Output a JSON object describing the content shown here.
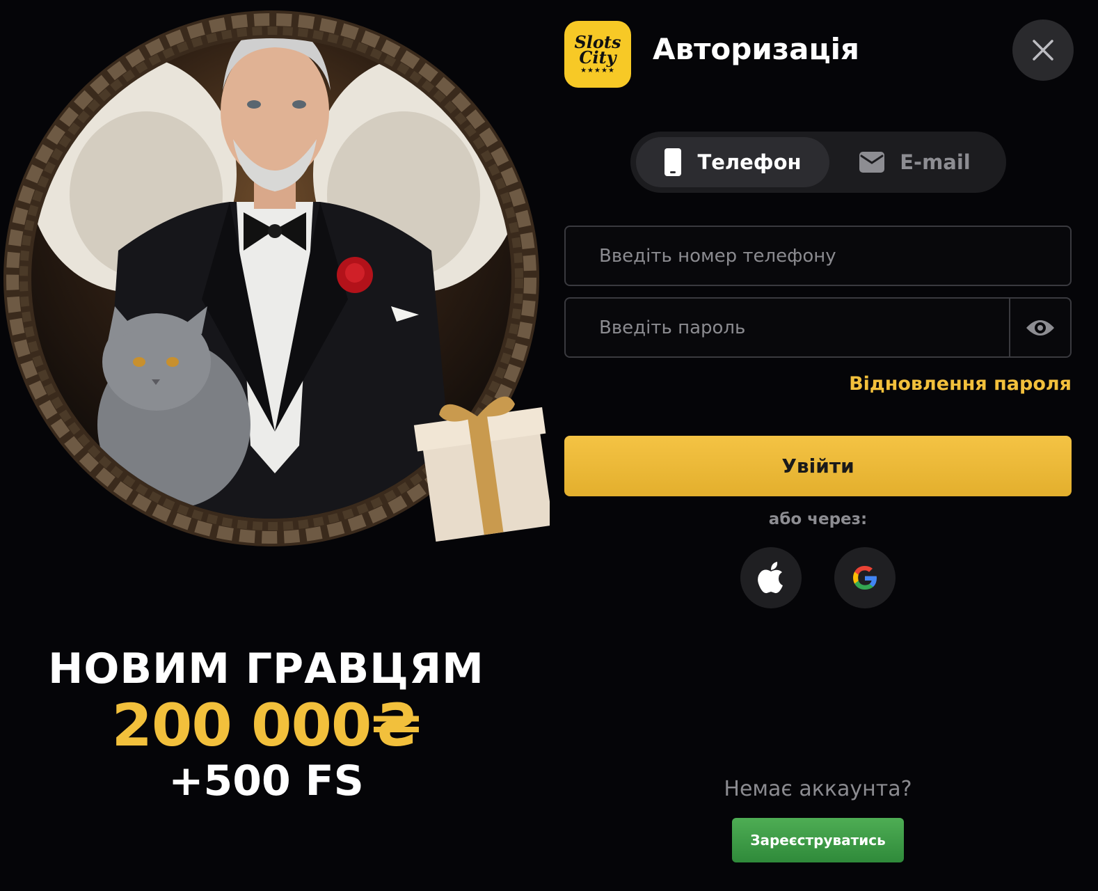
{
  "promo": {
    "line1": "НОВИМ ГРАВЦЯМ",
    "amount": "200 000₴",
    "free_spins": "+500 FS"
  },
  "logo": {
    "text_line1": "Slots",
    "text_line2": "City",
    "stars": "★★★★★",
    "color": "#f7c926"
  },
  "header": {
    "title": "Авторизація"
  },
  "tabs": [
    {
      "label": "Телефон",
      "icon": "phone-icon",
      "active": true
    },
    {
      "label": "E-mail",
      "icon": "mail-icon",
      "active": false
    }
  ],
  "form": {
    "phone_placeholder": "Введіть номер телефону",
    "password_placeholder": "Введіть пароль",
    "forgot_label": "Відновлення пароля",
    "submit_label": "Увійти",
    "or_label": "або через:"
  },
  "social": [
    {
      "icon": "apple-icon"
    },
    {
      "icon": "google-icon"
    }
  ],
  "footer": {
    "no_account": "Немає аккаунта?",
    "register_label": "Зареєструватись"
  },
  "colors": {
    "accent": "#f2c03c",
    "register_green": "#3c9a45",
    "background": "#050508"
  }
}
